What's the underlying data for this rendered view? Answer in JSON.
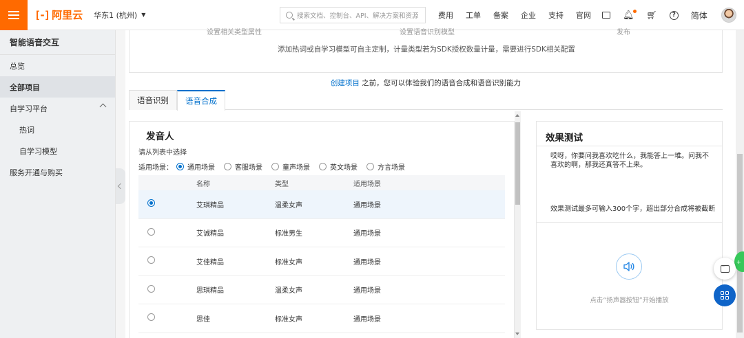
{
  "topbar": {
    "logo_text": "阿里云",
    "region": "华东1 (杭州)",
    "search_placeholder": "搜索文档、控制台、API、解决方案和资源",
    "links": [
      "费用",
      "工单",
      "备案",
      "企业",
      "支持",
      "官网"
    ],
    "language": "简体"
  },
  "sidebar": {
    "title": "智能语音交互",
    "items": [
      {
        "label": "总览"
      },
      {
        "label": "全部项目"
      },
      {
        "label": "自学习平台"
      },
      {
        "label": "热词"
      },
      {
        "label": "自学习模型"
      },
      {
        "label": "服务开通与购买"
      }
    ]
  },
  "banner": {
    "cut_texts": [
      "设置相关类型属性",
      "设置语音识别模型",
      "发布"
    ],
    "note": "添加热词或自学习模型可自主定制，计量类型若为SDK授权数量计量，需要进行SDK相关配置"
  },
  "hint": {
    "link": "创建项目",
    "text": "之前，您可以体验我们的语音合成和语音识别能力"
  },
  "tabs": [
    {
      "label": "语音识别"
    },
    {
      "label": "语音合成"
    }
  ],
  "voices": {
    "title": "发音人",
    "subtitle": "请从列表中选择",
    "filter_label": "适用场景：",
    "filter_options": [
      "通用场景",
      "客服场景",
      "童声场景",
      "英文场景",
      "方言场景"
    ],
    "selected_filter": "通用场景",
    "columns": [
      "名称",
      "类型",
      "适用场景"
    ],
    "rows": [
      {
        "name": "艾琪精品",
        "type": "温柔女声",
        "scene": "通用场景",
        "selected": true
      },
      {
        "name": "艾诚精品",
        "type": "标准男生",
        "scene": "通用场景",
        "selected": false
      },
      {
        "name": "艾佳精品",
        "type": "标准女声",
        "scene": "通用场景",
        "selected": false
      },
      {
        "name": "思琪精品",
        "type": "温柔女声",
        "scene": "通用场景",
        "selected": false
      },
      {
        "name": "思佳",
        "type": "标准女声",
        "scene": "通用场景",
        "selected": false
      }
    ]
  },
  "effect_test": {
    "title": "效果测试",
    "sample_text": "哎呀，你要问我喜欢吃什么，我能答上一堆。问我不喜欢的啊，那我还真答不上来。",
    "limit_note": "效果测试最多可输入300个字，超出部分合成将被截断",
    "play_tip": "点击“扬声器按钮”开始播放"
  },
  "colors": {
    "brand": "#ff6a00",
    "accent": "#0070cc",
    "float_button": "#0f64c8"
  }
}
